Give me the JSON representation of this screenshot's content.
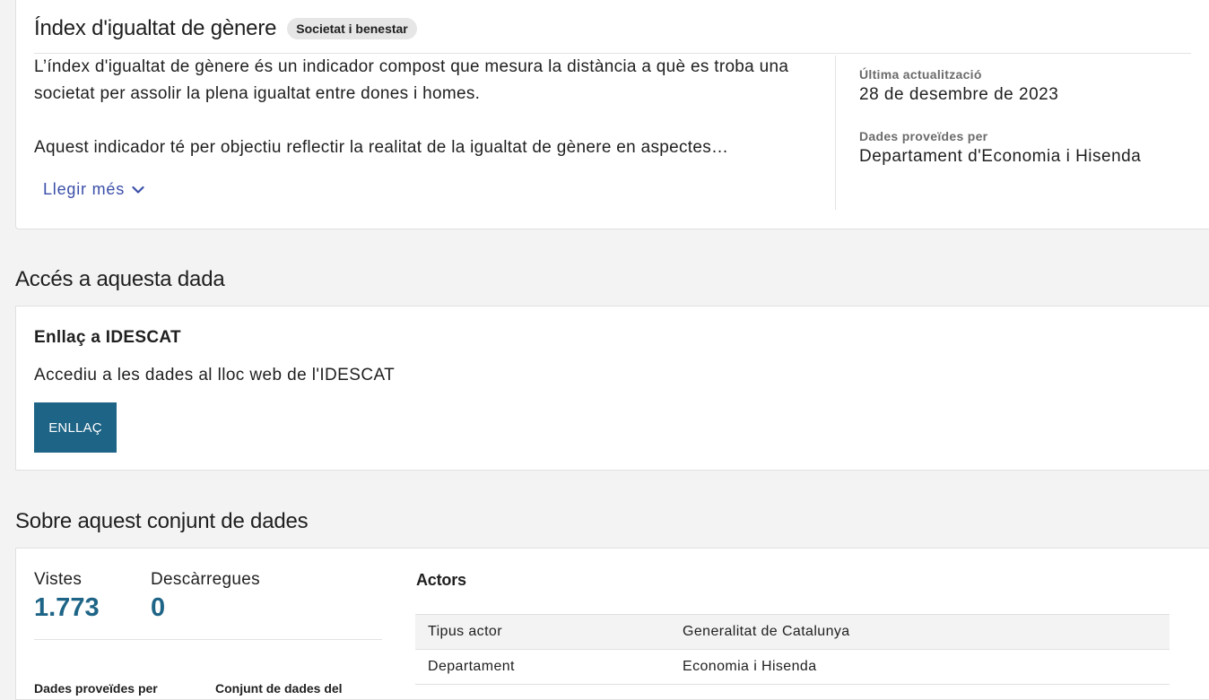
{
  "dataset": {
    "title": "Índex d'igualtat de gènere",
    "category_badge": "Societat i benestar",
    "description_p1": "L’índex d'igualtat de gènere és un indicador compost que mesura la distància a què es troba una societat per assolir la plena igualtat entre dones i homes.",
    "description_p2": "Aquest indicador té per objectiu reflectir la realitat de la igualtat de gènere en aspectes…",
    "read_more": "Llegir més",
    "last_update_label": "Última actualització",
    "last_update_value": "28 de desembre de 2023",
    "provider_label": "Dades proveïdes per",
    "provider_value": "Departament d'Economia i Hisenda"
  },
  "access": {
    "section_title": "Accés a aquesta dada",
    "link_title": "Enllaç a IDESCAT",
    "link_description": "Accediu a les dades al lloc web de l'IDESCAT",
    "button_label": "ENLLAÇ"
  },
  "about": {
    "section_title": "Sobre aquest conjunt de dades",
    "views_label": "Vistes",
    "views_value": "1.773",
    "downloads_label": "Descàrregues",
    "downloads_value": "0",
    "provided_by_label": "Dades proveïdes per",
    "collection_label": "Conjunt de dades del",
    "actors_title": "Actors",
    "actors": [
      {
        "key": "Tipus actor",
        "value": "Generalitat de Catalunya"
      },
      {
        "key": "Departament",
        "value": "Economia i Hisenda"
      }
    ]
  },
  "colors": {
    "accent": "#1e6486",
    "link": "#3b4fa8",
    "background": "#f3f3f3"
  },
  "icons": {
    "read_more": "chevron-down-icon"
  }
}
